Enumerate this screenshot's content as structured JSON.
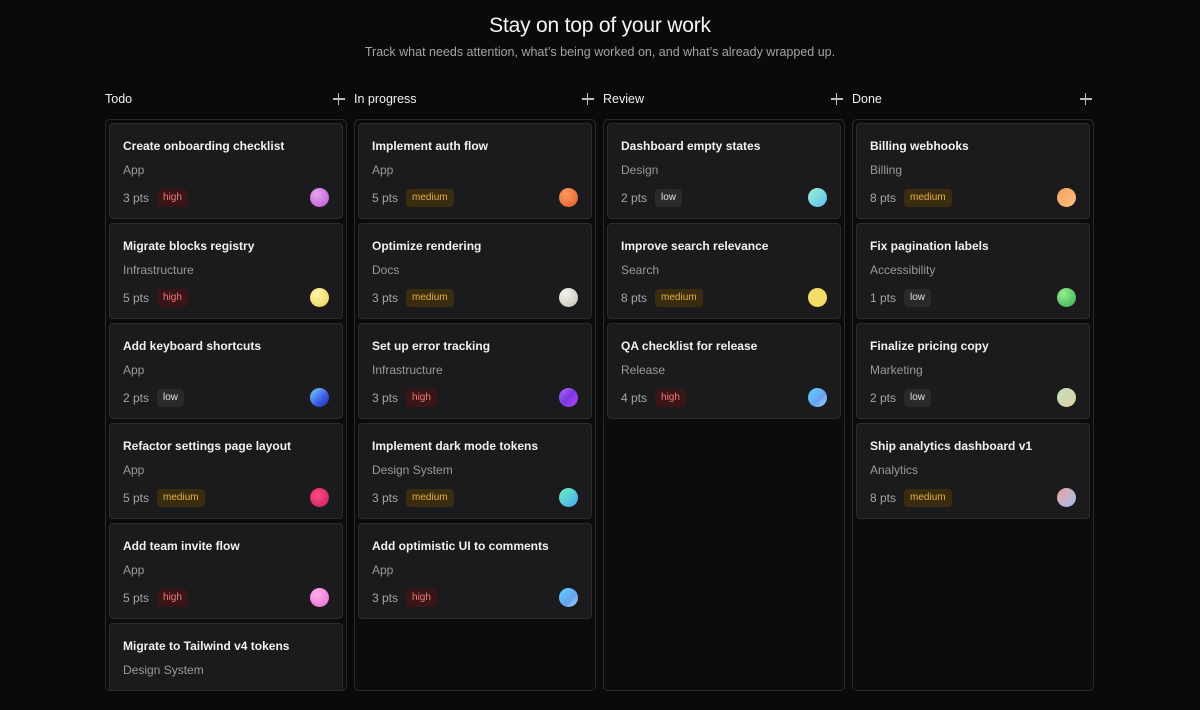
{
  "header": {
    "title": "Stay on top of your work",
    "subtitle": "Track what needs attention, what’s being worked on, and what’s already wrapped up."
  },
  "columns": [
    {
      "name": "Todo",
      "cards": [
        {
          "title": "Create onboarding checklist",
          "project": "App",
          "points": "3 pts",
          "priority": "high",
          "avatar": "av1"
        },
        {
          "title": "Migrate blocks registry",
          "project": "Infrastructure",
          "points": "5 pts",
          "priority": "high",
          "avatar": "av2"
        },
        {
          "title": "Add keyboard shortcuts",
          "project": "App",
          "points": "2 pts",
          "priority": "low",
          "avatar": "av3"
        },
        {
          "title": "Refactor settings page layout",
          "project": "App",
          "points": "5 pts",
          "priority": "medium",
          "avatar": "av4"
        },
        {
          "title": "Add team invite flow",
          "project": "App",
          "points": "5 pts",
          "priority": "high",
          "avatar": "av5"
        },
        {
          "title": "Migrate to Tailwind v4 tokens",
          "project": "Design System",
          "points": "",
          "priority": "",
          "avatar": ""
        }
      ]
    },
    {
      "name": "In progress",
      "cards": [
        {
          "title": "Implement auth flow",
          "project": "App",
          "points": "5 pts",
          "priority": "medium",
          "avatar": "av6"
        },
        {
          "title": "Optimize rendering",
          "project": "Docs",
          "points": "3 pts",
          "priority": "medium",
          "avatar": "av7"
        },
        {
          "title": "Set up error tracking",
          "project": "Infrastructure",
          "points": "3 pts",
          "priority": "high",
          "avatar": "av8"
        },
        {
          "title": "Implement dark mode tokens",
          "project": "Design System",
          "points": "3 pts",
          "priority": "medium",
          "avatar": "av9"
        },
        {
          "title": "Add optimistic UI to comments",
          "project": "App",
          "points": "3 pts",
          "priority": "high",
          "avatar": "av10"
        }
      ]
    },
    {
      "name": "Review",
      "cards": [
        {
          "title": "Dashboard empty states",
          "project": "Design",
          "points": "2 pts",
          "priority": "low",
          "avatar": "av11"
        },
        {
          "title": "Improve search relevance",
          "project": "Search",
          "points": "8 pts",
          "priority": "medium",
          "avatar": "av12"
        },
        {
          "title": "QA checklist for release",
          "project": "Release",
          "points": "4 pts",
          "priority": "high",
          "avatar": "av10"
        }
      ]
    },
    {
      "name": "Done",
      "cards": [
        {
          "title": "Billing webhooks",
          "project": "Billing",
          "points": "8 pts",
          "priority": "medium",
          "avatar": "av13"
        },
        {
          "title": "Fix pagination labels",
          "project": "Accessibility",
          "points": "1 pts",
          "priority": "low",
          "avatar": "av14"
        },
        {
          "title": "Finalize pricing copy",
          "project": "Marketing",
          "points": "2 pts",
          "priority": "low",
          "avatar": "av15"
        },
        {
          "title": "Ship analytics dashboard v1",
          "project": "Analytics",
          "points": "8 pts",
          "priority": "medium",
          "avatar": "av16"
        }
      ]
    }
  ]
}
